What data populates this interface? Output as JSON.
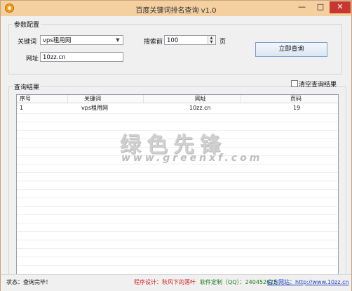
{
  "window": {
    "title": "百度关键词排名查询 v1.0",
    "controls": {
      "minimize": "—",
      "maximize": "□",
      "close": "✕"
    }
  },
  "params": {
    "legend": "参数配置",
    "keyword_label": "关键词",
    "keyword_value": "vps租用网",
    "search_label": "搜索前",
    "search_value": "100",
    "search_unit": "页",
    "url_label": "网址",
    "url_value": "10zz.cn",
    "query_button": "立即查询"
  },
  "results": {
    "legend": "查询结果",
    "clear_label": "清空查询结果",
    "clear_checked": false,
    "columns": [
      "序号",
      "关键词",
      "网址",
      "页码"
    ],
    "rows": [
      [
        "1",
        "vps租用网",
        "10zz.cn",
        "19"
      ]
    ]
  },
  "watermark": {
    "title": "绿色先锋",
    "url": "www.greenxf.com"
  },
  "status": {
    "state": "状态：查询完毕！",
    "designer": "程序设计：秋风下的落叶",
    "custom": "软件定制（QQ）：240452625",
    "website": "官方网站：http://www.10zz.cn"
  },
  "colors": {
    "titlebar": "#f4cfa0",
    "designer_text": "#d42020",
    "custom_text": "#1a7a1a",
    "website_text": "#1f3fbf"
  }
}
